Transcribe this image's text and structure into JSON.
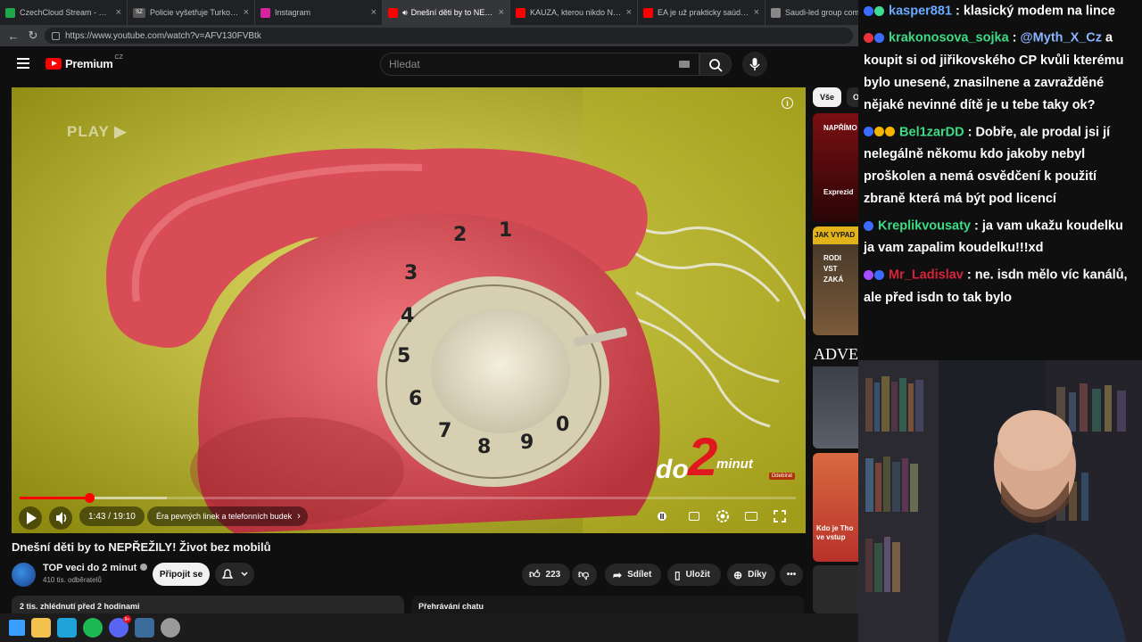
{
  "browser": {
    "tabs": [
      {
        "title": "CzechCloud Stream - Watch",
        "favicon_color": "#1fa84a",
        "active": false
      },
      {
        "title": "Policie vyšetřuje Turkovu nej",
        "favicon_color": "#555555",
        "favicon_text": "SZ",
        "active": false
      },
      {
        "title": "Instagram",
        "favicon_color": "#d6249f",
        "active": false
      },
      {
        "title": "Dnešní děti by to NEPŘE",
        "favicon_color": "#ff0000",
        "active": true
      },
      {
        "title": "KAUZA, kterou nikdo NECHÁ",
        "favicon_color": "#ff0000",
        "active": false
      },
      {
        "title": "EA je už prakticky saúdská. E",
        "favicon_color": "#ff0000",
        "active": false
      },
      {
        "title": "Saudi-led group complet",
        "favicon_color": "#888888",
        "active": false
      }
    ],
    "url": "https://www.youtube.com/watch?v=AFV130FVBtk"
  },
  "youtube": {
    "logo_text": "Premium",
    "logo_region": "CZ",
    "search_placeholder": "Hledat",
    "overlay_text": "PLAY ▶",
    "brand": {
      "do": "do",
      "two": "2",
      "minut": "minut"
    },
    "watermark": "Odebírat",
    "player": {
      "time": "1:43 / 19:10",
      "played_fraction": 0.09,
      "buffered_fraction": 0.19,
      "chapter": "Éra pevných linek a telefonních budek"
    },
    "title": "Dnešní děti by to NEPŘEŽILY! Život bez mobilů",
    "channel": {
      "name": "TOP veci do 2 minut",
      "subscribers": "410 tis. odběratelů"
    },
    "join_label": "Připojit se",
    "actions": {
      "likes": "223",
      "share": "Sdílet",
      "save": "Uložit",
      "thanks": "Díky"
    },
    "description_header": "2 tis. zhlédnutí  před 2 hodinami",
    "chat_replay": "Přehrávání chatu",
    "rec_chips": {
      "all": "Vše",
      "other": "O"
    },
    "rec_thumbs": [
      {
        "text_top": "NAPŘÍMO",
        "text_bottom": "Exprezid"
      },
      {
        "text_top": "JAK VYPAD",
        "text_bottom": "RODI VST ZAKÁ"
      },
      {
        "text_top": "ADVE",
        "text_bottom": ""
      },
      {
        "text_top": "",
        "text_bottom": "Kdo je Tho ve vstup"
      }
    ]
  },
  "chat": {
    "messages": [
      {
        "user": "kasper881",
        "user_color": "#6aaaff",
        "badges": [
          "#3b6cff",
          "#3ddc97"
        ],
        "text": ": klasický modem na lince"
      },
      {
        "user": "krakonosova_sojka",
        "user_color": "#3ddc84",
        "badges": [
          "#e8333b",
          "#3b6cff"
        ],
        "text": ": @Myth_X_Cz a koupit si od jiřikovského CP kvůli kterému bylo unesené, znasilnene a zavražděné nějaké nevinné dítě je u tebe taky ok?",
        "mention": "@Myth_X_Cz",
        "mention_color": "#8ab4ff"
      },
      {
        "user": "Bel1zarDD",
        "user_color": "#3ddc84",
        "badges": [
          "#3b6cff",
          "#f5b400",
          "#f5b400"
        ],
        "text": ": Dobře, ale prodal jsi jí nelegálně někomu kdo jakoby nebyl proškolen a nemá osvědčení k použití zbraně která má být pod licencí"
      },
      {
        "user": "Kreplikvousaty",
        "user_color": "#3ddc84",
        "badges": [
          "#3b6cff"
        ],
        "text": ": ja vam ukažu koudelku ja vam zapalim koudelku!!!xd"
      },
      {
        "user": "Mr_Ladislav",
        "user_color": "#d8243a",
        "badges": [
          "#a64dff",
          "#3b6cff"
        ],
        "text": ": ne. isdn mělo víc kanálů, ale před isdn to tak bylo"
      }
    ]
  },
  "taskbar": {
    "icons": [
      {
        "name": "windows-start-icon",
        "color": "#3aa0ff"
      },
      {
        "name": "file-explorer-icon",
        "color": "#f2c14e"
      },
      {
        "name": "edge-browser-icon",
        "color": "#1fa3d8"
      },
      {
        "name": "spotify-icon",
        "color": "#1db954"
      },
      {
        "name": "discord-icon",
        "color": "#5865f2",
        "badge": "9+"
      },
      {
        "name": "steam-icon",
        "color": "#3a6b9a"
      },
      {
        "name": "settings-app-icon",
        "color": "#9a9a9a"
      }
    ]
  }
}
